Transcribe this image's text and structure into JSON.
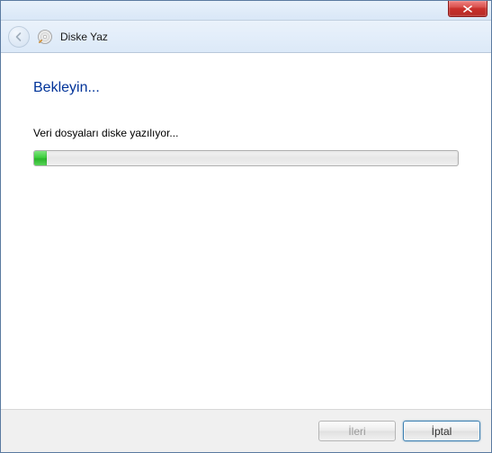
{
  "window": {
    "title": "Diske Yaz"
  },
  "content": {
    "heading": "Bekleyin...",
    "status_text": "Veri dosyaları diske yazılıyor...",
    "progress_percent": 3
  },
  "footer": {
    "next_label": "İleri",
    "cancel_label": "İptal"
  }
}
